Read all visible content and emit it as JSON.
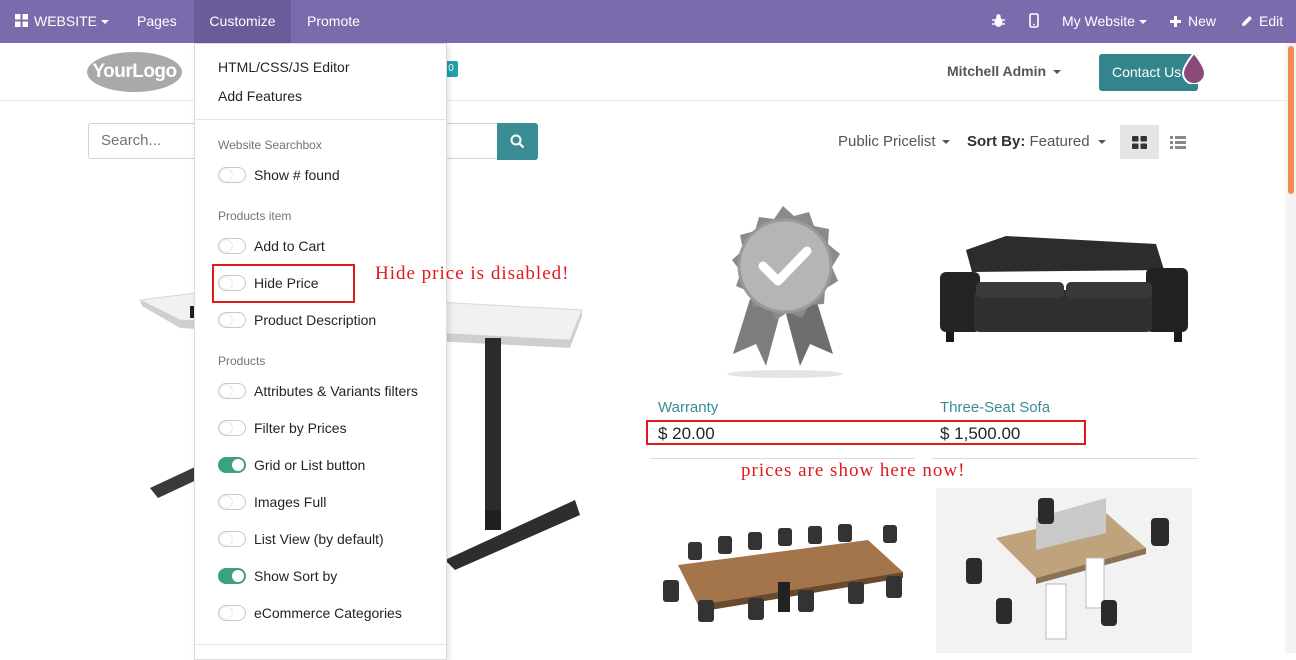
{
  "topbar": {
    "website": "WEBSITE",
    "pages": "Pages",
    "customize": "Customize",
    "promote": "Promote",
    "my_website": "My Website",
    "new": "New",
    "edit": "Edit"
  },
  "header": {
    "logo_text": "YourLogo",
    "cart_count": "0",
    "user": "Mitchell Admin",
    "contact": "Contact Us"
  },
  "search": {
    "placeholder": "Search..."
  },
  "toolbar": {
    "pricelist": "Public Pricelist",
    "sort_label": "Sort By:",
    "sort_value": "Featured"
  },
  "customize_menu": {
    "editor": "HTML/CSS/JS Editor",
    "add_features": "Add Features",
    "groups": [
      {
        "header": "Website Searchbox",
        "options": [
          {
            "label": "Show # found",
            "on": false
          }
        ]
      },
      {
        "header": "Products item",
        "options": [
          {
            "label": "Add to Cart",
            "on": false
          },
          {
            "label": "Hide Price",
            "on": false
          },
          {
            "label": "Product Description",
            "on": false
          }
        ]
      },
      {
        "header": "Products",
        "options": [
          {
            "label": "Attributes & Variants filters",
            "on": false
          },
          {
            "label": "Filter by Prices",
            "on": false
          },
          {
            "label": "Grid or List button",
            "on": true
          },
          {
            "label": "Images Full",
            "on": false
          },
          {
            "label": "List View (by default)",
            "on": false
          },
          {
            "label": "Show Sort by",
            "on": true
          },
          {
            "label": "eCommerce Categories",
            "on": false
          }
        ]
      }
    ]
  },
  "products": [
    {
      "name": "Warranty",
      "price": "$ 20.00"
    },
    {
      "name": "Three-Seat Sofa",
      "price": "$ 1,500.00"
    }
  ],
  "annotations": {
    "hide_price": "Hide price is disabled!",
    "prices_shown": "prices are show here now!"
  },
  "colors": {
    "topbar": "#7c6bac",
    "accent": "#3a8d95",
    "annotation": "#e0191d",
    "toggle_on": "#3aa37d"
  }
}
